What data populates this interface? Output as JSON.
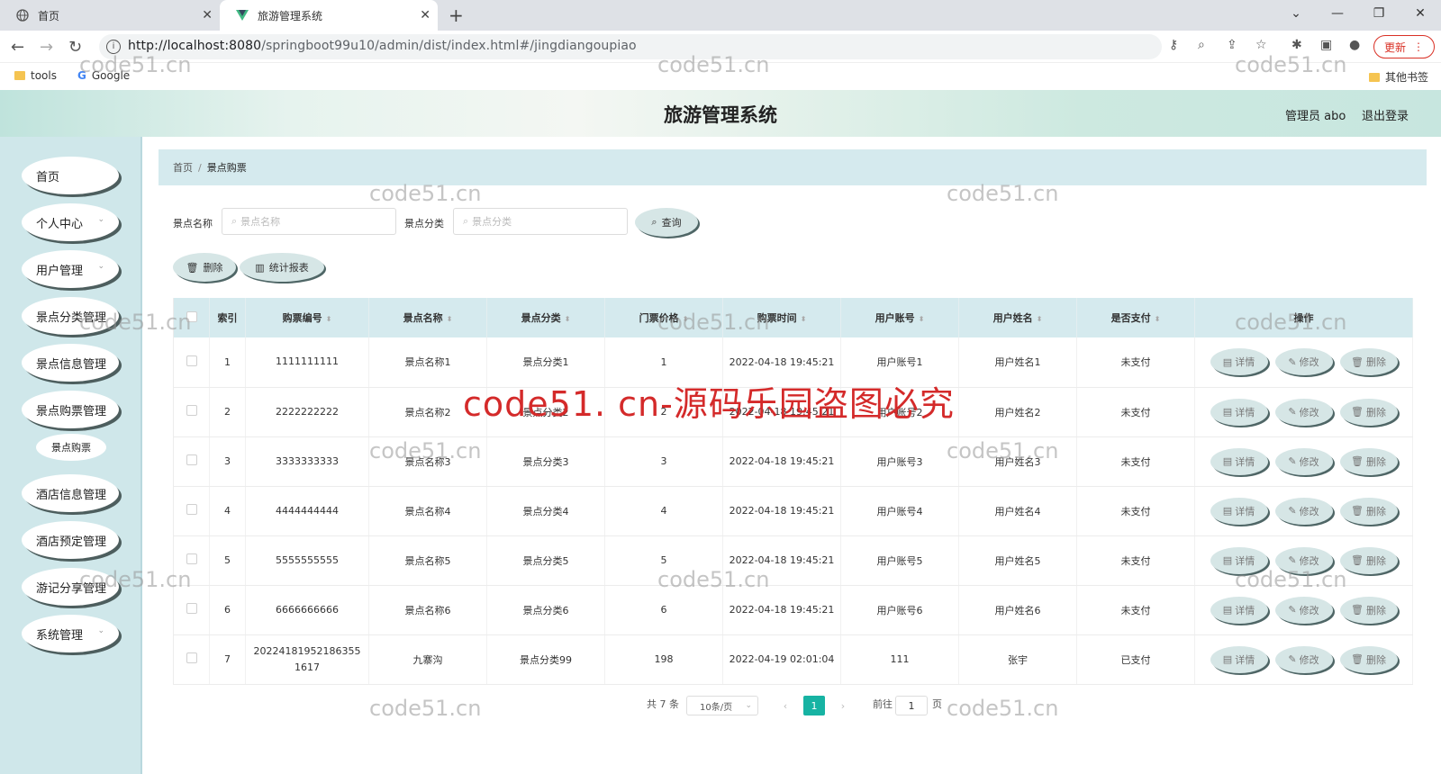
{
  "browser": {
    "tabs": [
      {
        "title": "首页",
        "active": false
      },
      {
        "title": "旅游管理系统",
        "active": true
      }
    ],
    "url_host": "http://localhost:8080",
    "url_path": "/springboot99u10/admin/dist/index.html#/jingdiangoupiao",
    "update_label": "更新",
    "bookmarks": [
      {
        "label": "tools",
        "icon": "folder-icon"
      },
      {
        "label": "Google",
        "icon": "google-icon"
      }
    ],
    "other_bookmarks": "其他书签"
  },
  "header": {
    "title": "旅游管理系统",
    "admin_label": "管理员 abo",
    "logout_label": "退出登录"
  },
  "sidebar": {
    "items": [
      {
        "label": "首页",
        "has_chevron": false
      },
      {
        "label": "个人中心",
        "has_chevron": true
      },
      {
        "label": "用户管理",
        "has_chevron": true
      },
      {
        "label": "景点分类管理",
        "has_chevron": false
      },
      {
        "label": "景点信息管理",
        "has_chevron": false
      },
      {
        "label": "景点购票管理",
        "has_chevron": false
      },
      {
        "label": "酒店信息管理",
        "has_chevron": false
      },
      {
        "label": "酒店预定管理",
        "has_chevron": false
      },
      {
        "label": "游记分享管理",
        "has_chevron": false
      },
      {
        "label": "系统管理",
        "has_chevron": true
      }
    ],
    "sub_item": "景点购票"
  },
  "breadcrumb": {
    "home": "首页",
    "separator": "/",
    "current": "景点购票"
  },
  "search": {
    "name_label": "景点名称",
    "name_placeholder": "景点名称",
    "category_label": "景点分类",
    "category_placeholder": "景点分类",
    "query_button": "查询"
  },
  "actions": {
    "delete": "删除",
    "report": "统计报表"
  },
  "table": {
    "headers": [
      "索引",
      "购票编号",
      "景点名称",
      "景点分类",
      "门票价格",
      "购票时间",
      "用户账号",
      "用户姓名",
      "是否支付",
      "操作"
    ],
    "rows": [
      {
        "index": "1",
        "ticket_no": "1111111111",
        "name": "景点名称1",
        "category": "景点分类1",
        "price": "1",
        "time": "2022-04-18 19:45:21",
        "account": "用户账号1",
        "user": "用户姓名1",
        "paid": "未支付"
      },
      {
        "index": "2",
        "ticket_no": "2222222222",
        "name": "景点名称2",
        "category": "景点分类2",
        "price": "2",
        "time": "2022-04-18 19:45:21",
        "account": "用户账号2",
        "user": "用户姓名2",
        "paid": "未支付"
      },
      {
        "index": "3",
        "ticket_no": "3333333333",
        "name": "景点名称3",
        "category": "景点分类3",
        "price": "3",
        "time": "2022-04-18 19:45:21",
        "account": "用户账号3",
        "user": "用户姓名3",
        "paid": "未支付"
      },
      {
        "index": "4",
        "ticket_no": "4444444444",
        "name": "景点名称4",
        "category": "景点分类4",
        "price": "4",
        "time": "2022-04-18 19:45:21",
        "account": "用户账号4",
        "user": "用户姓名4",
        "paid": "未支付"
      },
      {
        "index": "5",
        "ticket_no": "5555555555",
        "name": "景点名称5",
        "category": "景点分类5",
        "price": "5",
        "time": "2022-04-18 19:45:21",
        "account": "用户账号5",
        "user": "用户姓名5",
        "paid": "未支付"
      },
      {
        "index": "6",
        "ticket_no": "6666666666",
        "name": "景点名称6",
        "category": "景点分类6",
        "price": "6",
        "time": "2022-04-18 19:45:21",
        "account": "用户账号6",
        "user": "用户姓名6",
        "paid": "未支付"
      },
      {
        "index": "7",
        "ticket_no": "202241819521863551617",
        "name": "九寨沟",
        "category": "景点分类99",
        "price": "198",
        "time": "2022-04-19 02:01:04",
        "account": "111",
        "user": "张宇",
        "paid": "已支付"
      }
    ],
    "row_actions": {
      "detail": "详情",
      "edit": "修改",
      "delete": "删除"
    }
  },
  "pagination": {
    "total": "共 7 条",
    "page_size": "10条/页",
    "current_page": "1",
    "goto_prefix": "前往",
    "goto_value": "1",
    "goto_suffix": "页"
  },
  "watermark": {
    "small": "code51.cn",
    "big": "code51. cn-源码乐园盗图必究"
  },
  "colors": {
    "accent": "#17b3a3",
    "sidebar_bg": "#cfe7ea",
    "header_strip": "#d5eaee",
    "watermark_red": "#d42a2a"
  }
}
